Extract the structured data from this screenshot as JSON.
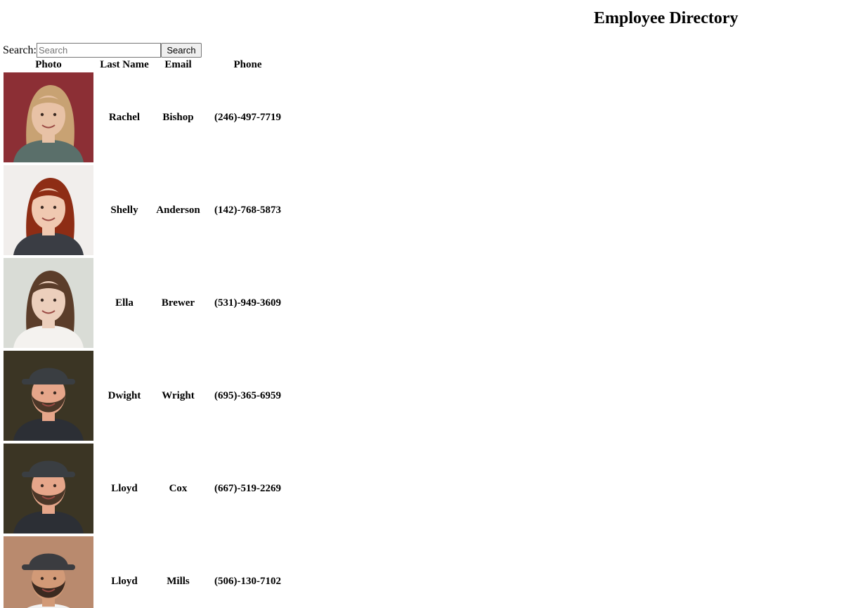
{
  "page": {
    "title": "Employee Directory"
  },
  "search": {
    "label": "Search:",
    "placeholder": "Search",
    "value": "",
    "button_label": "Search"
  },
  "table": {
    "headers": {
      "photo": "Photo",
      "last_name": "Last Name",
      "email": "Email",
      "phone": "Phone"
    },
    "rows": [
      {
        "first": "Rachel",
        "last": "Bishop",
        "phone": "(246)-497-7719",
        "photo": {
          "bg": "#8c2f35",
          "skin": "#e8c2a6",
          "hair": "#c8a273",
          "shirt": "#5a6f6a",
          "hat": null,
          "beard": null
        }
      },
      {
        "first": "Shelly",
        "last": "Anderson",
        "phone": "(142)-768-5873",
        "photo": {
          "bg": "#f1eeec",
          "skin": "#f0c9b1",
          "hair": "#8e2d15",
          "shirt": "#3a3d44",
          "hat": null,
          "beard": null
        }
      },
      {
        "first": "Ella",
        "last": "Brewer",
        "phone": "(531)-949-3609",
        "photo": {
          "bg": "#d9dcd6",
          "skin": "#eccfbc",
          "hair": "#5b3d2a",
          "shirt": "#f4f2ef",
          "hat": null,
          "beard": null
        }
      },
      {
        "first": "Dwight",
        "last": "Wright",
        "phone": "(695)-365-6959",
        "photo": {
          "bg": "#3b3524",
          "skin": "#e6a68a",
          "hair": "#4a3a2c",
          "shirt": "#2c2f35",
          "hat": "#3a3e42",
          "beard": "#4b3728"
        }
      },
      {
        "first": "Lloyd",
        "last": "Cox",
        "phone": "(667)-519-2269",
        "photo": {
          "bg": "#3b3524",
          "skin": "#e6a68a",
          "hair": "#4a3a2c",
          "shirt": "#2c2f35",
          "hat": "#3a3e42",
          "beard": "#4b3728"
        }
      },
      {
        "first": "Lloyd",
        "last": "Mills",
        "phone": "(506)-130-7102",
        "photo": {
          "bg": "#b98a6e",
          "skin": "#d29a77",
          "hair": "#2b211b",
          "shirt": "#f2f2f2",
          "hat": "#3b3c40",
          "beard": "#3b2a20"
        }
      }
    ]
  }
}
